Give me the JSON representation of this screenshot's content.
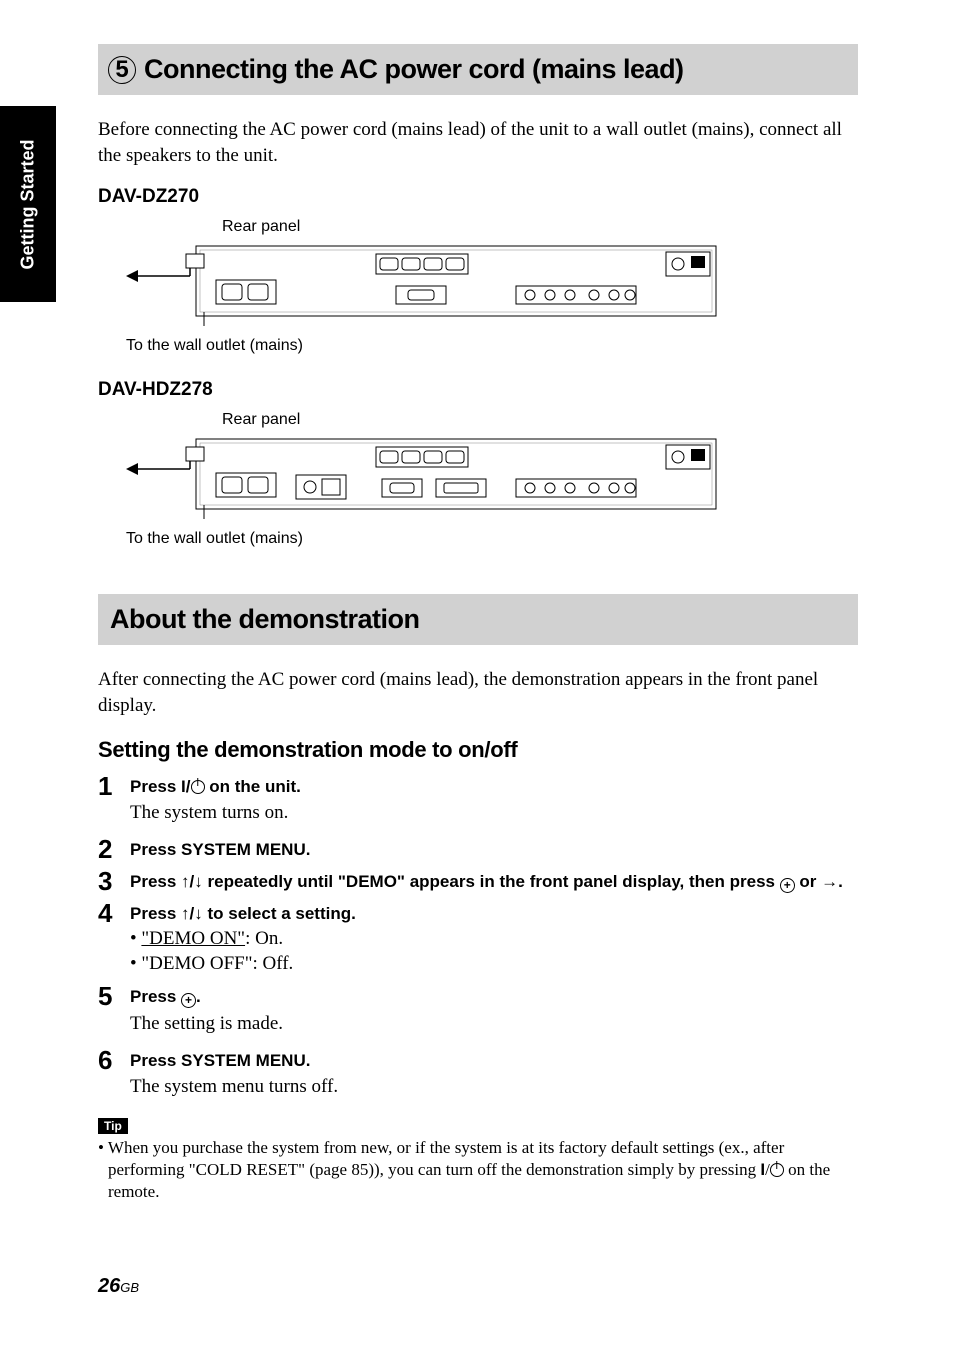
{
  "sideTab": "Getting Started",
  "section1": {
    "number": "5",
    "title": "Connecting the AC power cord (mains lead)",
    "intro": "Before connecting the AC power cord (mains lead) of the unit to a wall outlet (mains), connect all the speakers to the unit."
  },
  "model1": {
    "name": "DAV-DZ270",
    "rearPanelLabel": "Rear panel",
    "outletLabel": "To the wall outlet (mains)"
  },
  "model2": {
    "name": "DAV-HDZ278",
    "rearPanelLabel": "Rear panel",
    "outletLabel": "To the wall outlet (mains)"
  },
  "section2": {
    "title": "About the demonstration",
    "intro": "After connecting the AC power cord (mains lead), the demonstration appears in the front panel display.",
    "subhead": "Setting the demonstration mode to on/off"
  },
  "steps": [
    {
      "n": "1",
      "instr_pre": "Press ",
      "instr_mid": "/",
      "instr_post": " on the unit.",
      "plain": "The system turns on."
    },
    {
      "n": "2",
      "instr": "Press SYSTEM MENU."
    },
    {
      "n": "3",
      "instr_pre": "Press ",
      "arrows": "↑/↓",
      "instr_mid": " repeatedly until \"DEMO\" appears in the front panel display, then press ",
      "instr_post": " or →."
    },
    {
      "n": "4",
      "instr_pre": "Press ",
      "arrows": "↑/↓",
      "instr_post": " to select a setting.",
      "bullets": [
        {
          "label": "\"DEMO ON\"",
          "rest": ": On.",
          "underline": true
        },
        {
          "label": "\"DEMO OFF\"",
          "rest": ": Off.",
          "underline": false
        }
      ]
    },
    {
      "n": "5",
      "instr_pre": "Press ",
      "instr_post": ".",
      "plain": "The setting is made."
    },
    {
      "n": "6",
      "instr": "Press SYSTEM MENU.",
      "plain": "The system menu turns off."
    }
  ],
  "tip": {
    "label": "Tip",
    "text_pre": "• When you purchase the system from new, or if the system is at its factory default settings (ex., after performing \"COLD RESET\" (page 85)), you can turn off the demonstration simply by pressing ",
    "text_post": " on the remote."
  },
  "pageNumber": "26",
  "pageSuffix": "GB"
}
